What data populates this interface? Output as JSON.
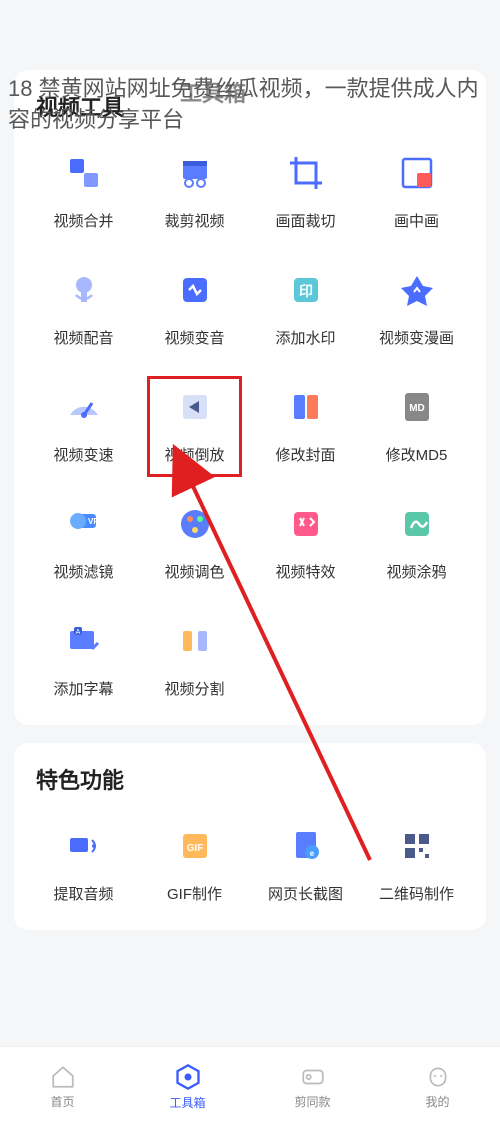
{
  "header_overlay": "18 禁黄网站网址免费丝瓜视频，一款提供成人内容的视频分享平台",
  "header_bg_title": "工具箱",
  "section1": {
    "title": "视频工具",
    "tools": [
      {
        "label": "视频合并",
        "icon": "merge-icon"
      },
      {
        "label": "裁剪视频",
        "icon": "trim-icon"
      },
      {
        "label": "画面裁切",
        "icon": "crop-icon"
      },
      {
        "label": "画中画",
        "icon": "pip-icon"
      },
      {
        "label": "视频配音",
        "icon": "dub-icon"
      },
      {
        "label": "视频变音",
        "icon": "voicechange-icon"
      },
      {
        "label": "添加水印",
        "icon": "watermark-icon"
      },
      {
        "label": "视频变漫画",
        "icon": "comic-icon"
      },
      {
        "label": "视频变速",
        "icon": "speed-icon"
      },
      {
        "label": "视频倒放",
        "icon": "reverse-icon",
        "highlight": true
      },
      {
        "label": "修改封面",
        "icon": "cover-icon"
      },
      {
        "label": "修改MD5",
        "icon": "md5-icon"
      },
      {
        "label": "视频滤镜",
        "icon": "filter-icon"
      },
      {
        "label": "视频调色",
        "icon": "color-icon"
      },
      {
        "label": "视频特效",
        "icon": "fx-icon"
      },
      {
        "label": "视频涂鸦",
        "icon": "doodle-icon"
      },
      {
        "label": "添加字幕",
        "icon": "subtitle-icon"
      },
      {
        "label": "视频分割",
        "icon": "split-icon"
      }
    ]
  },
  "section2": {
    "title": "特色功能",
    "tools": [
      {
        "label": "提取音频",
        "icon": "extract-audio-icon"
      },
      {
        "label": "GIF制作",
        "icon": "gif-icon"
      },
      {
        "label": "网页长截图",
        "icon": "webcapture-icon"
      },
      {
        "label": "二维码制作",
        "icon": "qrcode-icon"
      }
    ]
  },
  "nav": [
    {
      "label": "首页",
      "icon": "home-icon"
    },
    {
      "label": "工具箱",
      "icon": "toolbox-icon",
      "active": true
    },
    {
      "label": "剪同款",
      "icon": "template-icon"
    },
    {
      "label": "我的",
      "icon": "profile-icon"
    }
  ],
  "colors": {
    "accent": "#3a5cff",
    "highlight": "#e02020"
  }
}
